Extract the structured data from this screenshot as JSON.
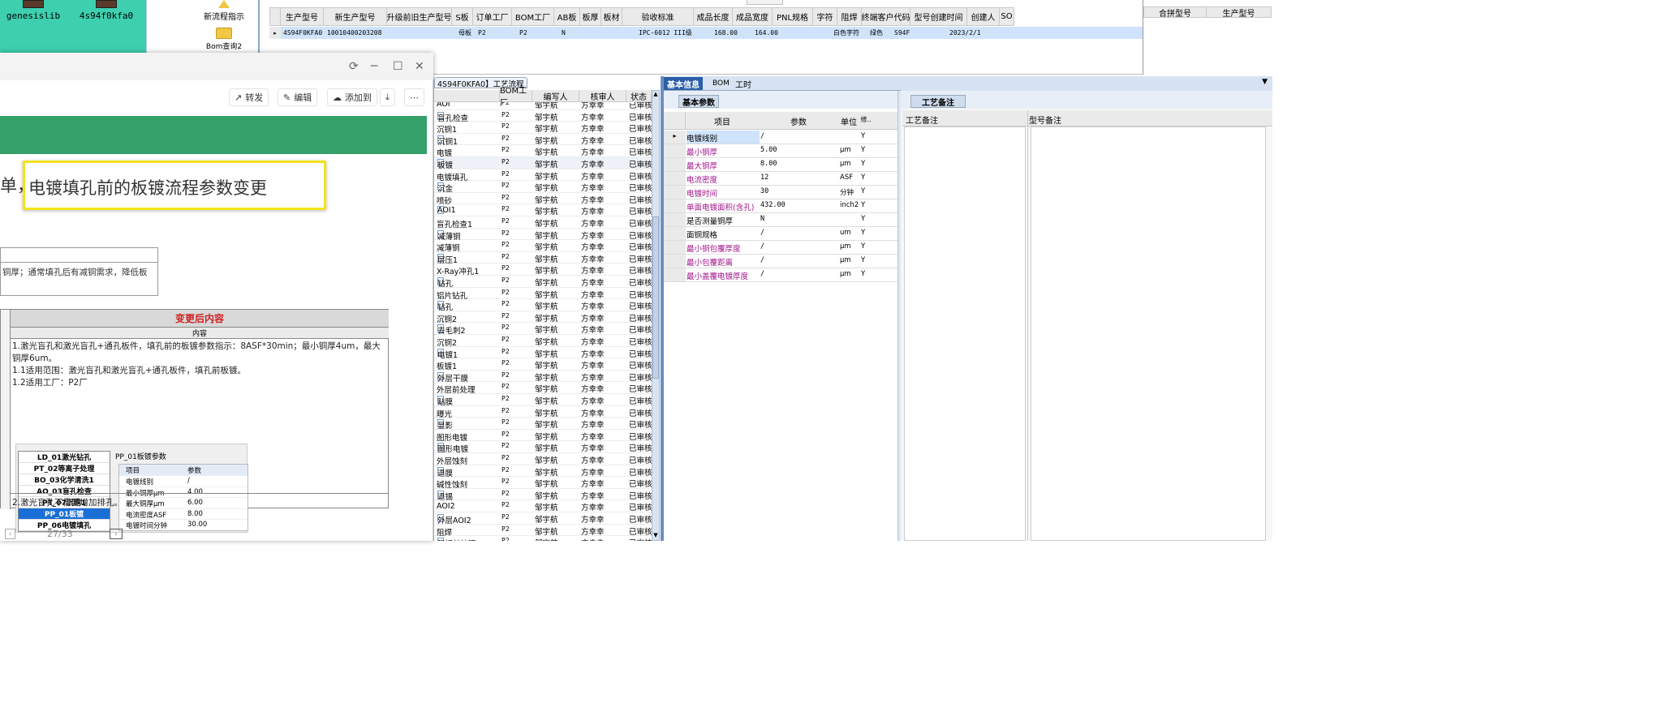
{
  "desktop": {
    "icons": [
      {
        "label": "genesislib"
      },
      {
        "label": "4s94f0kfa0"
      }
    ]
  },
  "toolbar": {
    "new_flow": "新流程指示",
    "bom_query": "Bom查询2"
  },
  "order_grid": {
    "columns": [
      "生产型号",
      "新生产型号",
      "升级前旧生产型号",
      "S板",
      "订单工厂",
      "BOM工厂",
      "AB板",
      "板厚",
      "板材",
      "验收标准",
      "成品长度",
      "成品宽度",
      "PNL规格",
      "字符",
      "阻焊",
      "终端客户代码",
      "型号创建时间",
      "创建人",
      "SO"
    ],
    "row": {
      "prod_model": "4S94F0KFA0",
      "new_model": "10010400203208",
      "s_board": "母板",
      "order_factory": "P2",
      "bom_factory": "P2",
      "ab_board": "N",
      "standard": "IPC-6012 III级",
      "length": "168.00",
      "width": "164.00",
      "char": "白色字符",
      "mask": "绿色",
      "customer": "S94F",
      "created": "2023/2/1"
    },
    "right_columns": [
      "合拼型号",
      "生产型号"
    ]
  },
  "viewer": {
    "actions": [
      "转发",
      "编辑",
      "添加到"
    ],
    "highlight_prefix": "单，",
    "highlight_title": "电镀填孔前的板镀流程参数变更",
    "old_text": "铜厚；通常填孔后有减铜需求，降低板",
    "new_header": "变更后内容",
    "new_sub": "内容",
    "lines": [
      "1.激光盲孔和激光盲孔+通孔板件，填孔前的板镀参数指示：8ASF*30min；最小铜厚4um，最大",
      "铜厚6um。",
      "1.1适用范围：激光盲孔和激光盲孔+通孔板件，填孔前板镀。",
      "1.2适用工厂：P2厂"
    ],
    "inner_steps": [
      "LD_01激光钻孔",
      "PT_02等离子处理",
      "BO_03化学清洗1",
      "AO_03盲孔检查",
      "PT_07沉铜1",
      "PP_01板镀",
      "PP_06电镀填孔"
    ],
    "inner_title": "PP_01板镀参数",
    "inner_head": [
      "项目",
      "参数"
    ],
    "inner_rows": [
      [
        "电镀线别",
        "/"
      ],
      [
        "最小铜厚μm",
        "4.00"
      ],
      [
        "最大铜厚μm",
        "6.00"
      ],
      [
        "电流密度ASF",
        "8.00"
      ],
      [
        "电镀时间分钟",
        "30.00"
      ]
    ],
    "line2": "2.激光盲孔不需要增加排孔。",
    "page": "27/33"
  },
  "workflow": {
    "title": "4S94F0KFA0】工艺流程",
    "columns": [
      "BOM工厂",
      "编写人",
      "核审人",
      "状态"
    ],
    "rows": [
      [
        "AOI",
        "P2"
      ],
      [
        "盲孔检查",
        "P2"
      ],
      [
        "沉铜1",
        "P2"
      ],
      [
        "沉铜1",
        "P2"
      ],
      [
        "电镀",
        "P2"
      ],
      [
        "板镀",
        "P2"
      ],
      [
        "电镀填孔",
        "P2"
      ],
      [
        "沉金",
        "P2"
      ],
      [
        "喷砂",
        "P2"
      ],
      [
        "AOI1",
        "P2"
      ],
      [
        "盲孔检查1",
        "P2"
      ],
      [
        "减薄铜",
        "P2"
      ],
      [
        "减薄铜",
        "P2"
      ],
      [
        "层压1",
        "P2"
      ],
      [
        "X-Ray冲孔1",
        "P2"
      ],
      [
        "钻孔",
        "P2"
      ],
      [
        "铝片钻孔",
        "P2"
      ],
      [
        "钻孔",
        "P2"
      ],
      [
        "沉铜2",
        "P2"
      ],
      [
        "去毛刺2",
        "P2"
      ],
      [
        "沉铜2",
        "P2"
      ],
      [
        "电镀1",
        "P2"
      ],
      [
        "板镀1",
        "P2"
      ],
      [
        "外层干膜",
        "P2"
      ],
      [
        "外层前处理",
        "P2"
      ],
      [
        "贴膜",
        "P2"
      ],
      [
        "曝光",
        "P2"
      ],
      [
        "显影",
        "P2"
      ],
      [
        "图形电镀",
        "P2"
      ],
      [
        "图形电镀",
        "P2"
      ],
      [
        "外层蚀刻",
        "P2"
      ],
      [
        "退膜",
        "P2"
      ],
      [
        "碱性蚀刻",
        "P2"
      ],
      [
        "退锡",
        "P2"
      ],
      [
        "AOI2",
        "P2"
      ],
      [
        "外层AOI2",
        "P2"
      ],
      [
        "阻焊",
        "P2"
      ],
      [
        "阻焊前处理",
        "P2"
      ]
    ],
    "writer": "邹宇航",
    "reviewer": "方幸幸",
    "status": "已审核"
  },
  "params": {
    "tabs": [
      "基本信息",
      "BOM",
      "工时"
    ],
    "sub_tab": "基本参数",
    "columns": [
      "项目",
      "参数",
      "单位",
      "修.."
    ],
    "rows": [
      {
        "item": "电镀线别",
        "value": "/",
        "unit": "",
        "flag": "Y",
        "color": "#000"
      },
      {
        "item": "最小铜厚",
        "value": "5.00",
        "unit": "μm",
        "flag": "Y",
        "color": "#a0158a"
      },
      {
        "item": "最大铜厚",
        "value": "8.00",
        "unit": "μm",
        "flag": "Y",
        "color": "#a0158a"
      },
      {
        "item": "电流密度",
        "value": "12",
        "unit": "ASF",
        "flag": "Y",
        "color": "#a0158a"
      },
      {
        "item": "电镀时间",
        "value": "30",
        "unit": "分钟",
        "flag": "Y",
        "color": "#a0158a"
      },
      {
        "item": "单面电镀面积(含孔)",
        "value": "432.00",
        "unit": "inch2",
        "flag": "Y",
        "color": "#a0158a"
      },
      {
        "item": "是否测量铜厚",
        "value": "N",
        "unit": "",
        "flag": "Y",
        "color": "#000"
      },
      {
        "item": "面铜规格",
        "value": "/",
        "unit": "um",
        "flag": "Y",
        "color": "#000"
      },
      {
        "item": "最小铜包覆厚度",
        "value": "/",
        "unit": "μm",
        "flag": "Y",
        "color": "#a0158a"
      },
      {
        "item": "最小包覆距离",
        "value": "/",
        "unit": "μm",
        "flag": "Y",
        "color": "#a0158a"
      },
      {
        "item": "最小盖覆电镀厚度",
        "value": "/",
        "unit": "μm",
        "flag": "Y",
        "color": "#a0158a"
      }
    ]
  },
  "notes": {
    "tab": "工艺备注",
    "col1": "工艺备注",
    "col2": "型号备注"
  }
}
